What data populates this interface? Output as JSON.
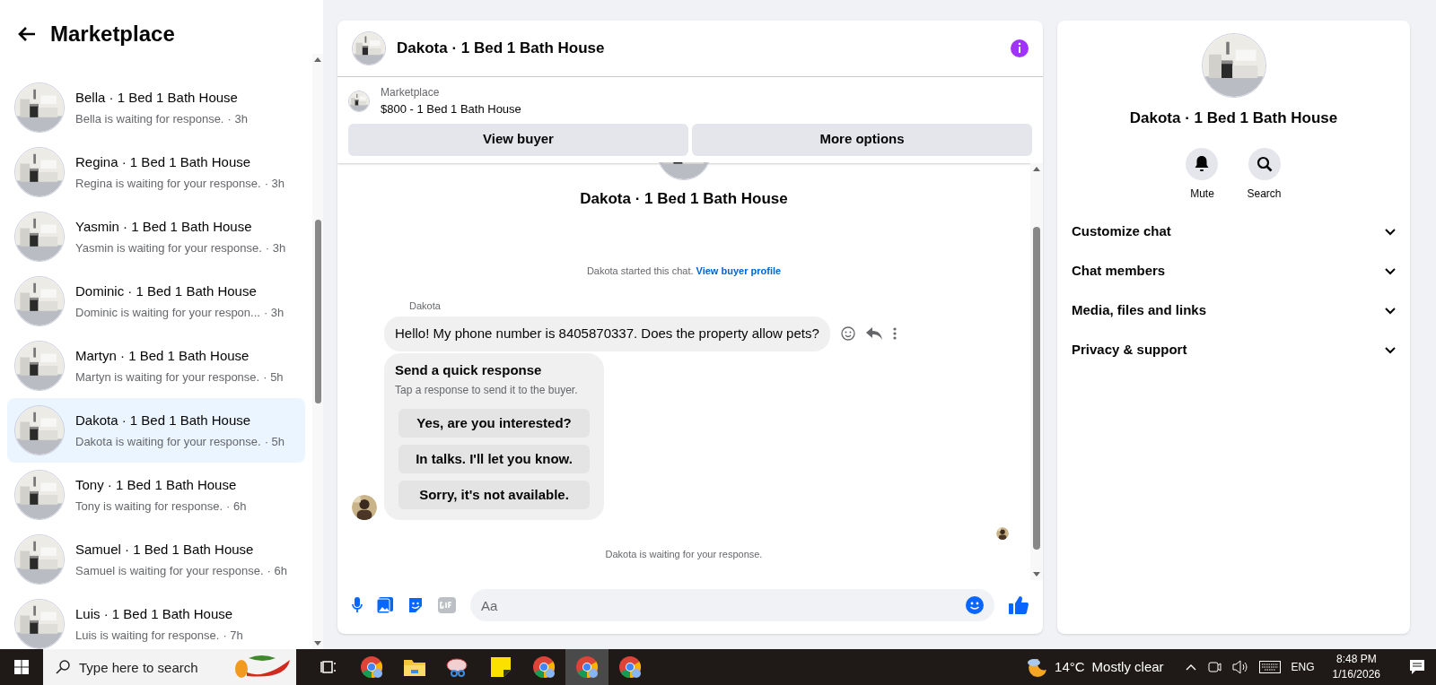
{
  "sidebar": {
    "title": "Marketplace",
    "conversations": [
      {
        "title": "Bella · 1 Bed 1 Bath House",
        "subtitle": "Bella is waiting for response.",
        "time": "· 3h",
        "selected": false
      },
      {
        "title": "Regina · 1 Bed 1 Bath House",
        "subtitle": "Regina is waiting for your response.",
        "time": "· 3h",
        "selected": false
      },
      {
        "title": "Yasmin · 1 Bed 1 Bath House",
        "subtitle": "Yasmin is waiting for your response.",
        "time": "· 3h",
        "selected": false
      },
      {
        "title": "Dominic · 1 Bed 1 Bath House",
        "subtitle": "Dominic is waiting for your respon...",
        "time": "· 3h",
        "selected": false
      },
      {
        "title": "Martyn · 1 Bed 1 Bath House",
        "subtitle": "Martyn is waiting for your response.",
        "time": "· 5h",
        "selected": false
      },
      {
        "title": "Dakota · 1 Bed 1 Bath House",
        "subtitle": "Dakota is waiting for your response.",
        "time": "· 5h",
        "selected": true
      },
      {
        "title": "Tony · 1 Bed 1 Bath House",
        "subtitle": "Tony is waiting for response.",
        "time": "· 6h",
        "selected": false
      },
      {
        "title": "Samuel · 1 Bed 1 Bath House",
        "subtitle": "Samuel is waiting for your response.",
        "time": "· 6h",
        "selected": false
      },
      {
        "title": "Luis · 1 Bed 1 Bath House",
        "subtitle": "Luis is waiting for response.",
        "time": "· 7h",
        "selected": false
      }
    ]
  },
  "chat": {
    "title": "Dakota · 1 Bed 1 Bath House",
    "listing": {
      "source": "Marketplace",
      "summary": "$800 - 1 Bed 1 Bath House"
    },
    "buttons": [
      "View buyer",
      "More options"
    ],
    "thread_title": "Dakota · 1 Bed 1 Bath House",
    "started_note": "Dakota started this chat.",
    "started_link": "View buyer profile",
    "sender": "Dakota",
    "message": "Hello! My phone number is 8405870337. Does the property allow pets?",
    "quick_response": {
      "title": "Send a quick response",
      "hint": "Tap a response to send it to the buyer.",
      "options": [
        "Yes, are you interested?",
        "In talks. I'll let you know.",
        "Sorry, it's not available."
      ]
    },
    "waiting_note": "Dakota is waiting for your response.",
    "composer": {
      "placeholder": "Aa"
    }
  },
  "details": {
    "title": "Dakota · 1 Bed 1 Bath House",
    "actions": [
      {
        "kind": "mute",
        "label": "Mute"
      },
      {
        "kind": "search",
        "label": "Search"
      }
    ],
    "sections": [
      "Customize chat",
      "Chat members",
      "Media, files and links",
      "Privacy & support"
    ]
  },
  "taskbar": {
    "search_placeholder": "Type here to search",
    "apps": [
      {
        "kind": "taskview",
        "selected": false
      },
      {
        "kind": "chrome",
        "selected": false
      },
      {
        "kind": "folder",
        "selected": false
      },
      {
        "kind": "snip",
        "selected": false
      },
      {
        "kind": "notes",
        "selected": false
      },
      {
        "kind": "chrome",
        "selected": false
      },
      {
        "kind": "chrome",
        "selected": true
      },
      {
        "kind": "chrome",
        "selected": false
      }
    ],
    "weather": {
      "temperature": "14°C",
      "condition": "Mostly clear"
    },
    "language": "ENG",
    "time": "8:48 PM",
    "date": "1/16/2026"
  }
}
